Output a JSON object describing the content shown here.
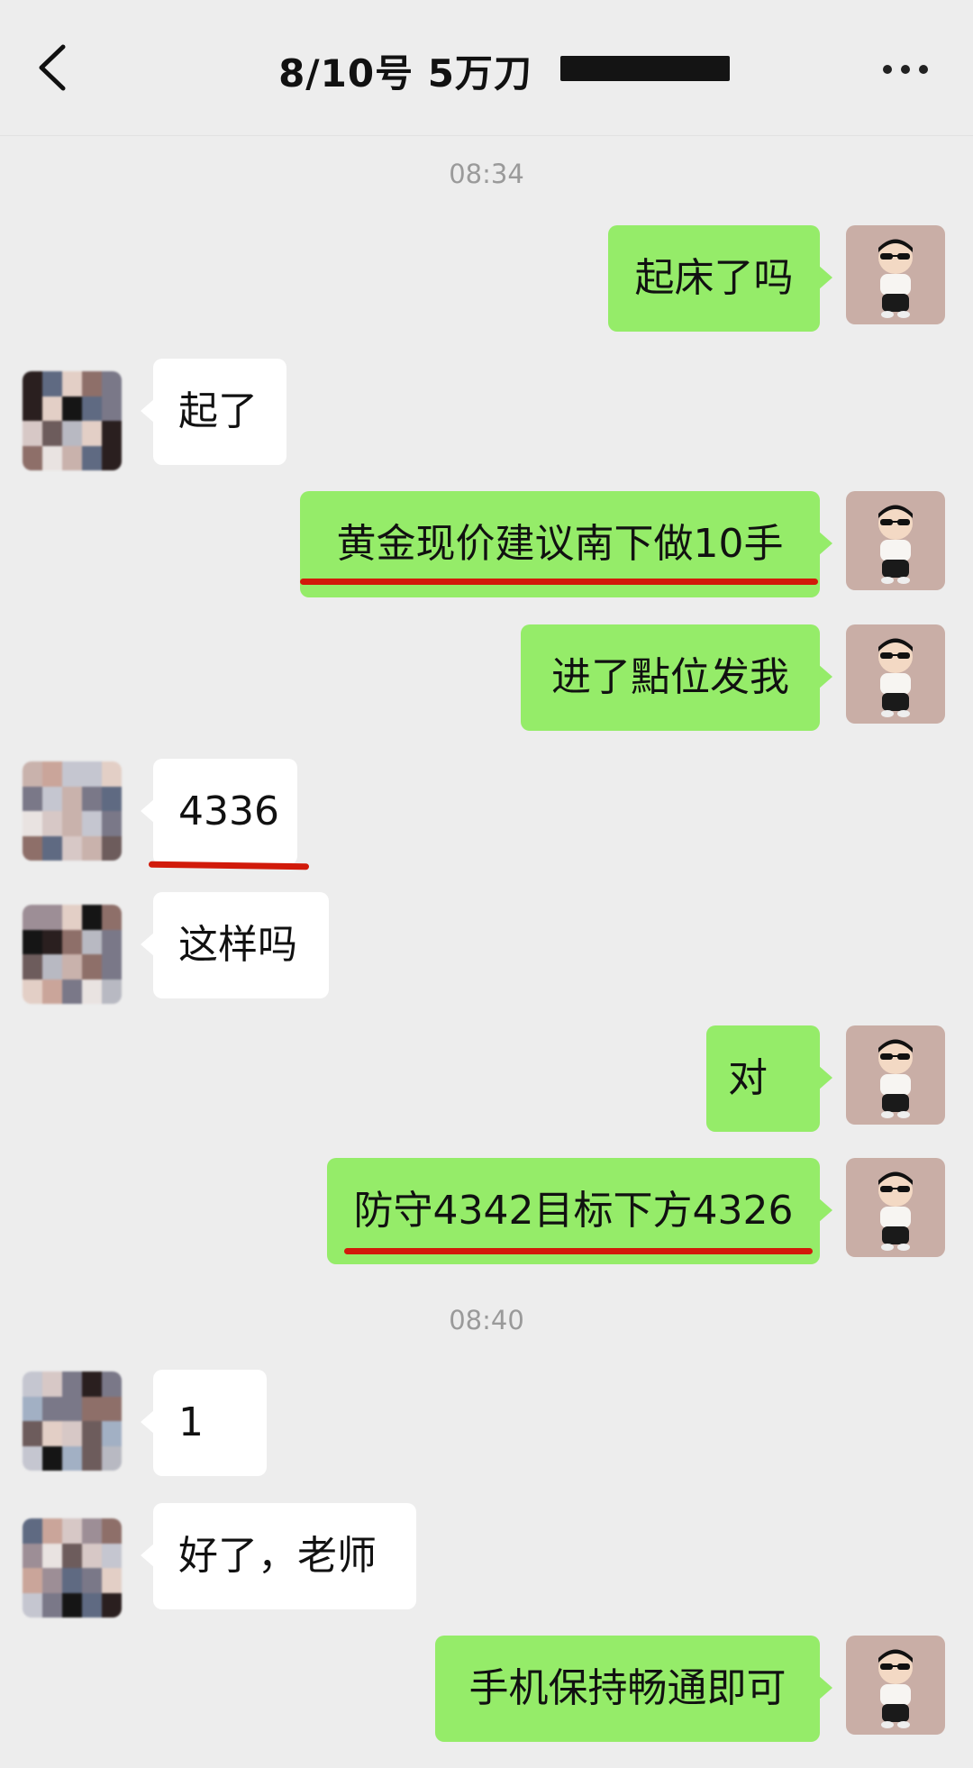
{
  "header": {
    "title": "8/10号  5万刀",
    "back_icon": "chevron-left-icon",
    "more_icon": "more-dots-icon"
  },
  "colors": {
    "background": "#ededed",
    "sent_bubble": "#95ec69",
    "received_bubble": "#ffffff",
    "underline": "#d11a0a"
  },
  "timestamps": [
    "08:34",
    "08:40"
  ],
  "messages": [
    {
      "side": "sent",
      "text": "起床了吗",
      "underlined": false
    },
    {
      "side": "received",
      "text": "起了",
      "underlined": false
    },
    {
      "side": "sent",
      "text": "黄金现价建议南下做10手",
      "underlined": true
    },
    {
      "side": "sent",
      "text": "进了點位发我",
      "underlined": false
    },
    {
      "side": "received",
      "text": "4336",
      "underlined": true
    },
    {
      "side": "received",
      "text": "这样吗",
      "underlined": false
    },
    {
      "side": "sent",
      "text": "对",
      "underlined": false
    },
    {
      "side": "sent",
      "text": "防守4342目标下方4326",
      "underlined": true
    },
    {
      "side": "received",
      "text": "1",
      "underlined": false
    },
    {
      "side": "received",
      "text": "好了，老师",
      "underlined": false
    },
    {
      "side": "sent",
      "text": "手机保持畅通即可",
      "underlined": false
    }
  ]
}
